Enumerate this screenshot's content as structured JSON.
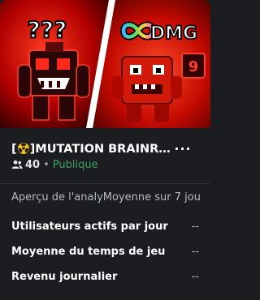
{
  "thumbnail": {
    "left_text": "???",
    "badge_text": "DMG",
    "badge_number": "9",
    "colors": {
      "background": "#7a0000",
      "accent": "#ff2a1a",
      "divider": "#ffffff"
    }
  },
  "game": {
    "title_prefix": "[",
    "title_icon": "radioactive-icon",
    "title_main": "]MUTATION BRAINRO...",
    "player_count": "40",
    "separator": "•",
    "visibility": "Publique",
    "more_label": "···"
  },
  "analytics": {
    "header": "Aperçu de l'analyMoyenne sur 7 jou",
    "rows": [
      {
        "label": "Utilisateurs actifs par jour",
        "value": "--"
      },
      {
        "label": "Moyenne du temps de jeu",
        "value": "--"
      },
      {
        "label": "Revenu journalier",
        "value": "--"
      }
    ]
  },
  "colors": {
    "card_bg": "#1c1d21",
    "status_green": "#3ba55d",
    "muted_text": "#b6b9bf"
  }
}
